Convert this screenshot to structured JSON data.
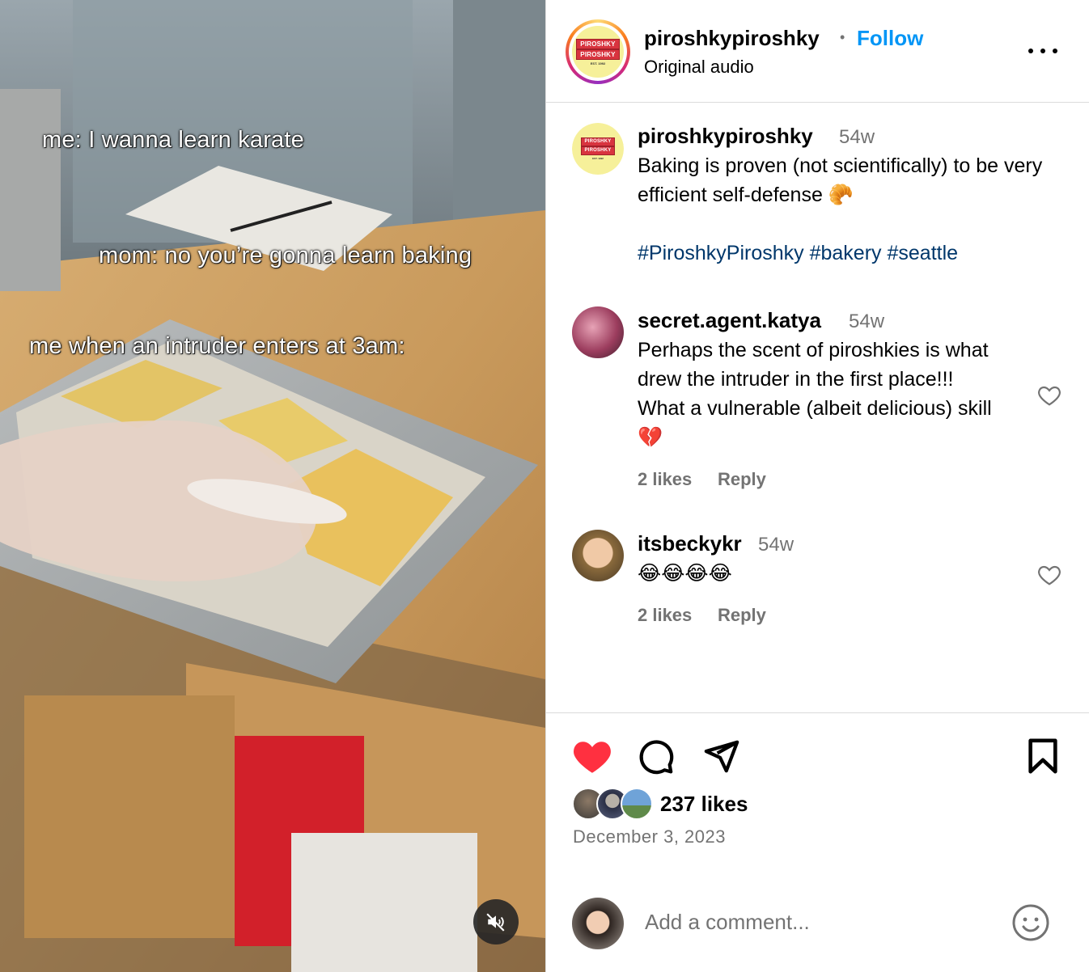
{
  "media": {
    "overlay_lines": [
      "me: I wanna learn karate",
      "mom: no you’re gonna learn baking",
      "me when an intruder enters at 3am:"
    ],
    "mute_icon": "speaker-muted-icon"
  },
  "header": {
    "username": "piroshkypiroshky",
    "separator": "•",
    "follow_label": "Follow",
    "audio_label": "Original audio",
    "logo_text_top": "PIROSHKY",
    "logo_text_bottom": "PIROSHKY",
    "logo_est": "EST. 1992"
  },
  "caption": {
    "username": "piroshkypiroshky",
    "time": "54w",
    "text": "Baking is proven (not scientifically) to be very efficient self-defense 🥐",
    "hashtags": [
      "#PiroshkyPiroshky",
      "#bakery",
      "#seattle"
    ]
  },
  "comments": [
    {
      "username": "secret.agent.katya",
      "time": "54w",
      "text": "Perhaps the scent of piroshkies is what drew the intruder in the first place!!! What a vulnerable (albeit delicious) skill 💔",
      "likes": "2 likes",
      "reply_label": "Reply"
    },
    {
      "username": "itsbeckykr",
      "time": "54w",
      "text": "😂😂😂😂",
      "likes": "2 likes",
      "reply_label": "Reply"
    }
  ],
  "actions": {
    "liked": true,
    "like_color": "#ff3040",
    "likes_count": "237 likes",
    "date": "December 3, 2023",
    "comment_placeholder": "Add a comment..."
  },
  "colors": {
    "follow": "#0095f6",
    "hashtag": "#00376b",
    "secondary_text": "#737373",
    "divider": "#dbdbdb"
  }
}
